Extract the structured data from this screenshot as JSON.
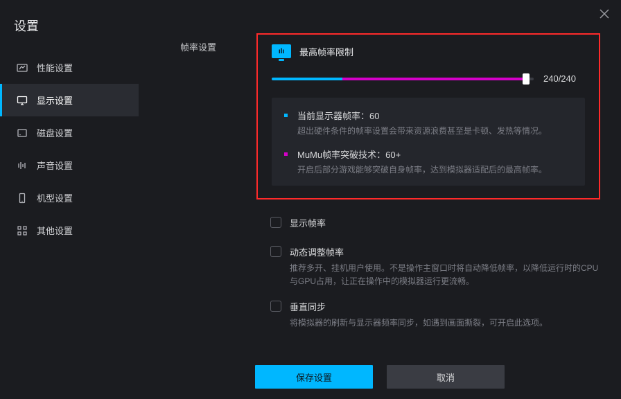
{
  "window": {
    "title": "设置"
  },
  "sidebar": {
    "items": [
      {
        "label": "性能设置"
      },
      {
        "label": "显示设置"
      },
      {
        "label": "磁盘设置"
      },
      {
        "label": "声音设置"
      },
      {
        "label": "机型设置"
      },
      {
        "label": "其他设置"
      }
    ]
  },
  "section": {
    "label": "帧率设置",
    "fps_title": "最高帧率限制",
    "slider_value": "240/240",
    "info1_title": "当前显示器帧率：60",
    "info1_desc": "超出硬件条件的帧率设置会带来资源浪费甚至是卡顿、发热等情况。",
    "info2_title": "MuMu帧率突破技术：60+",
    "info2_desc": "开启后部分游戏能够突破自身帧率，达到模拟器适配后的最高帧率。",
    "check1_label": "显示帧率",
    "check2_label": "动态调整帧率",
    "check2_desc": "推荐多开、挂机用户使用。不是操作主窗口时将自动降低帧率，以降低运行时的CPU与GPU占用，让正在操作中的模拟器运行更流畅。",
    "check3_label": "垂直同步",
    "check3_desc": "将模拟器的刷新与显示器频率同步，如遇到画面撕裂，可开启此选项。"
  },
  "footer": {
    "save_label": "保存设置",
    "cancel_label": "取消"
  }
}
